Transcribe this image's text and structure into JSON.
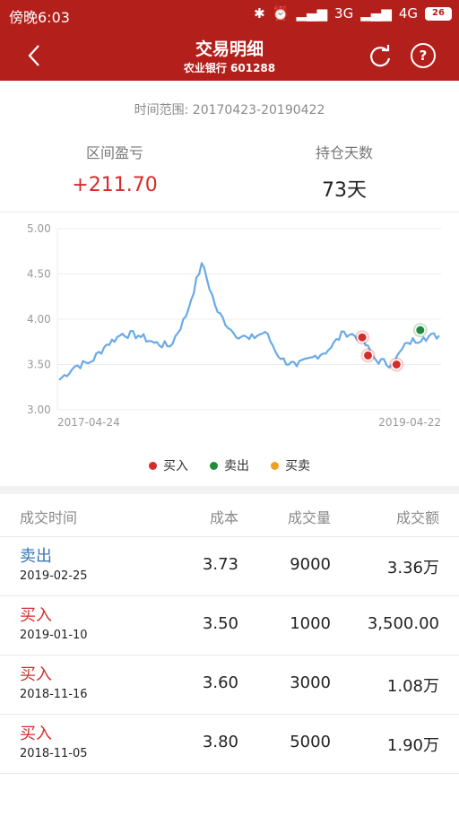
{
  "status_bar": {
    "time": "傍晚6:03",
    "network1": "3G",
    "network2": "4G",
    "battery": "26"
  },
  "header": {
    "title": "交易明细",
    "subtitle": "农业银行 601288"
  },
  "range_text": "时间范围: 20170423-20190422",
  "stats": {
    "profit_label": "区间盈亏",
    "profit_value": "+211.70",
    "days_label": "持仓天数",
    "days_value": "73天"
  },
  "colors": {
    "brand": "#b3201c",
    "buy": "#d62b2b",
    "sell": "#1e8c3a",
    "both": "#f0a020",
    "line": "#6aaae6"
  },
  "legend": [
    {
      "label": "买入",
      "color": "#d62b2b"
    },
    {
      "label": "卖出",
      "color": "#1e8c3a"
    },
    {
      "label": "买卖",
      "color": "#f0a020"
    }
  ],
  "chart_data": {
    "type": "line",
    "ylim": [
      3.0,
      5.0
    ],
    "y_ticks": [
      "5.00",
      "4.50",
      "4.00",
      "3.50",
      "3.00"
    ],
    "x_labels": [
      "2017-04-24",
      "2019-04-22"
    ],
    "x": [
      "2017-04",
      "2017-05",
      "2017-06",
      "2017-07",
      "2017-08",
      "2017-09",
      "2017-10",
      "2017-11",
      "2017-12",
      "2018-01",
      "2018-02",
      "2018-03",
      "2018-04",
      "2018-05",
      "2018-06",
      "2018-07",
      "2018-08",
      "2018-09",
      "2018-10",
      "2018-11",
      "2018-12",
      "2019-01",
      "2019-02",
      "2019-03",
      "2019-04"
    ],
    "values": [
      3.33,
      3.48,
      3.53,
      3.72,
      3.84,
      3.82,
      3.74,
      3.7,
      4.03,
      4.62,
      4.08,
      3.85,
      3.78,
      3.86,
      3.56,
      3.48,
      3.58,
      3.66,
      3.86,
      3.8,
      3.55,
      3.5,
      3.74,
      3.8,
      3.82
    ],
    "markers": [
      {
        "x": "2018-11-05",
        "value": 3.8,
        "kind": "buy"
      },
      {
        "x": "2018-11-16",
        "value": 3.6,
        "kind": "buy"
      },
      {
        "x": "2019-01-10",
        "value": 3.5,
        "kind": "buy"
      },
      {
        "x": "2019-02-25",
        "value": 3.88,
        "kind": "sell"
      }
    ]
  },
  "table": {
    "headers": {
      "time": "成交时间",
      "cost": "成本",
      "volume": "成交量",
      "amount": "成交额"
    },
    "rows": [
      {
        "type": "卖出",
        "kind": "sell",
        "date": "2019-02-25",
        "cost": "3.73",
        "volume": "9000",
        "amount": "3.36万"
      },
      {
        "type": "买入",
        "kind": "buy",
        "date": "2019-01-10",
        "cost": "3.50",
        "volume": "1000",
        "amount": "3,500.00"
      },
      {
        "type": "买入",
        "kind": "buy",
        "date": "2018-11-16",
        "cost": "3.60",
        "volume": "3000",
        "amount": "1.08万"
      },
      {
        "type": "买入",
        "kind": "buy",
        "date": "2018-11-05",
        "cost": "3.80",
        "volume": "5000",
        "amount": "1.90万"
      }
    ]
  }
}
